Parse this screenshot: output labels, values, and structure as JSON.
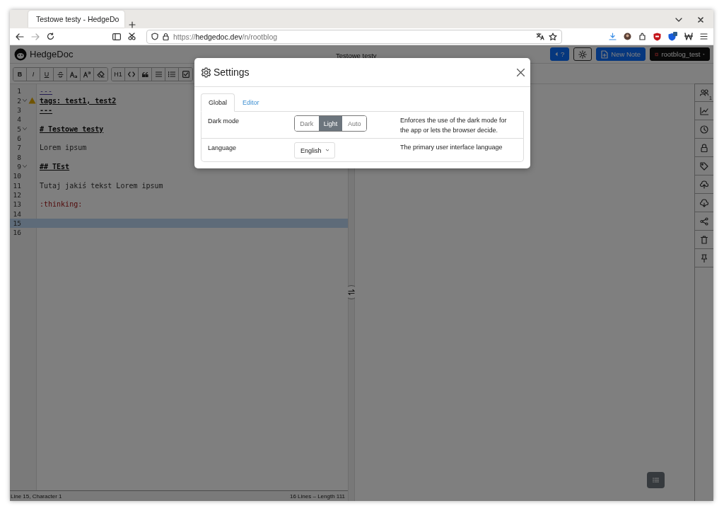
{
  "browser": {
    "tab": {
      "title": "Testowe testy - HedgeDo",
      "selected": true
    },
    "url": "https://**hedgedoc.dev**/n/rootblog"
  },
  "app": {
    "brand": "HedgeDoc",
    "note_title": "Testowe testy",
    "help_button": "?",
    "new_note_button": "New Note",
    "user_menu": "rootblog_test"
  },
  "toolbar": {
    "bold": "B",
    "italic": "I",
    "underline": "U",
    "heading": "H1"
  },
  "editor": {
    "lines": [
      {
        "number": "1",
        "text": "---",
        "kind": "rule",
        "active": false,
        "foldable": false,
        "warning": false
      },
      {
        "number": "2",
        "text": "tags: test1, test2",
        "kind": "strong",
        "active": false,
        "foldable": true,
        "warning": true
      },
      {
        "number": "3",
        "text": "---",
        "kind": "strong",
        "active": false,
        "foldable": false,
        "warning": false
      },
      {
        "number": "4",
        "active": false,
        "foldable": false,
        "warning": false
      },
      {
        "number": "5",
        "text": "# Testowe testy",
        "kind": "strong",
        "active": false,
        "foldable": true,
        "warning": false
      },
      {
        "number": "6",
        "active": false,
        "foldable": false,
        "warning": false
      },
      {
        "number": "7",
        "text": "Lorem ipsum",
        "kind": "plain",
        "active": false,
        "foldable": false,
        "warning": false
      },
      {
        "number": "8",
        "active": false,
        "foldable": false,
        "warning": false
      },
      {
        "number": "9",
        "text": "## TEst",
        "kind": "strong",
        "active": false,
        "foldable": true,
        "warning": false
      },
      {
        "number": "10",
        "active": false,
        "foldable": false,
        "warning": false
      },
      {
        "number": "11",
        "text": "Tutaj jakiś tekst Lorem ipsum",
        "kind": "plain",
        "active": false,
        "foldable": false,
        "warning": false
      },
      {
        "number": "12",
        "active": false,
        "foldable": false,
        "warning": false
      },
      {
        "number": "13",
        "text": ":thinking:",
        "kind": "emoji",
        "active": false,
        "foldable": false,
        "warning": false
      },
      {
        "number": "14",
        "active": false,
        "foldable": false,
        "warning": false
      },
      {
        "number": "15",
        "active": true,
        "foldable": false,
        "warning": false
      },
      {
        "number": "16",
        "active": false,
        "foldable": false,
        "warning": false
      }
    ]
  },
  "status_bar": {
    "position": "Line 15, Character 1",
    "stats": "16 Lines – Length 111"
  },
  "sidebar": {
    "online_count": "1"
  },
  "settings_dialog": {
    "title": "Settings",
    "tabs": [
      {
        "label": "Global",
        "selected": true
      },
      {
        "label": "Editor",
        "selected": false
      }
    ],
    "rows": [
      {
        "label": "Dark mode",
        "kind": "toggle",
        "options": [
          {
            "label": "Dark",
            "selected": false
          },
          {
            "label": "Light",
            "selected": true
          },
          {
            "label": "Auto",
            "selected": false
          }
        ],
        "description": "Enforces the use of the dark mode for the app or lets the browser decide."
      },
      {
        "label": "Language",
        "kind": "select",
        "value": "English",
        "description": "The primary user interface language"
      }
    ]
  }
}
